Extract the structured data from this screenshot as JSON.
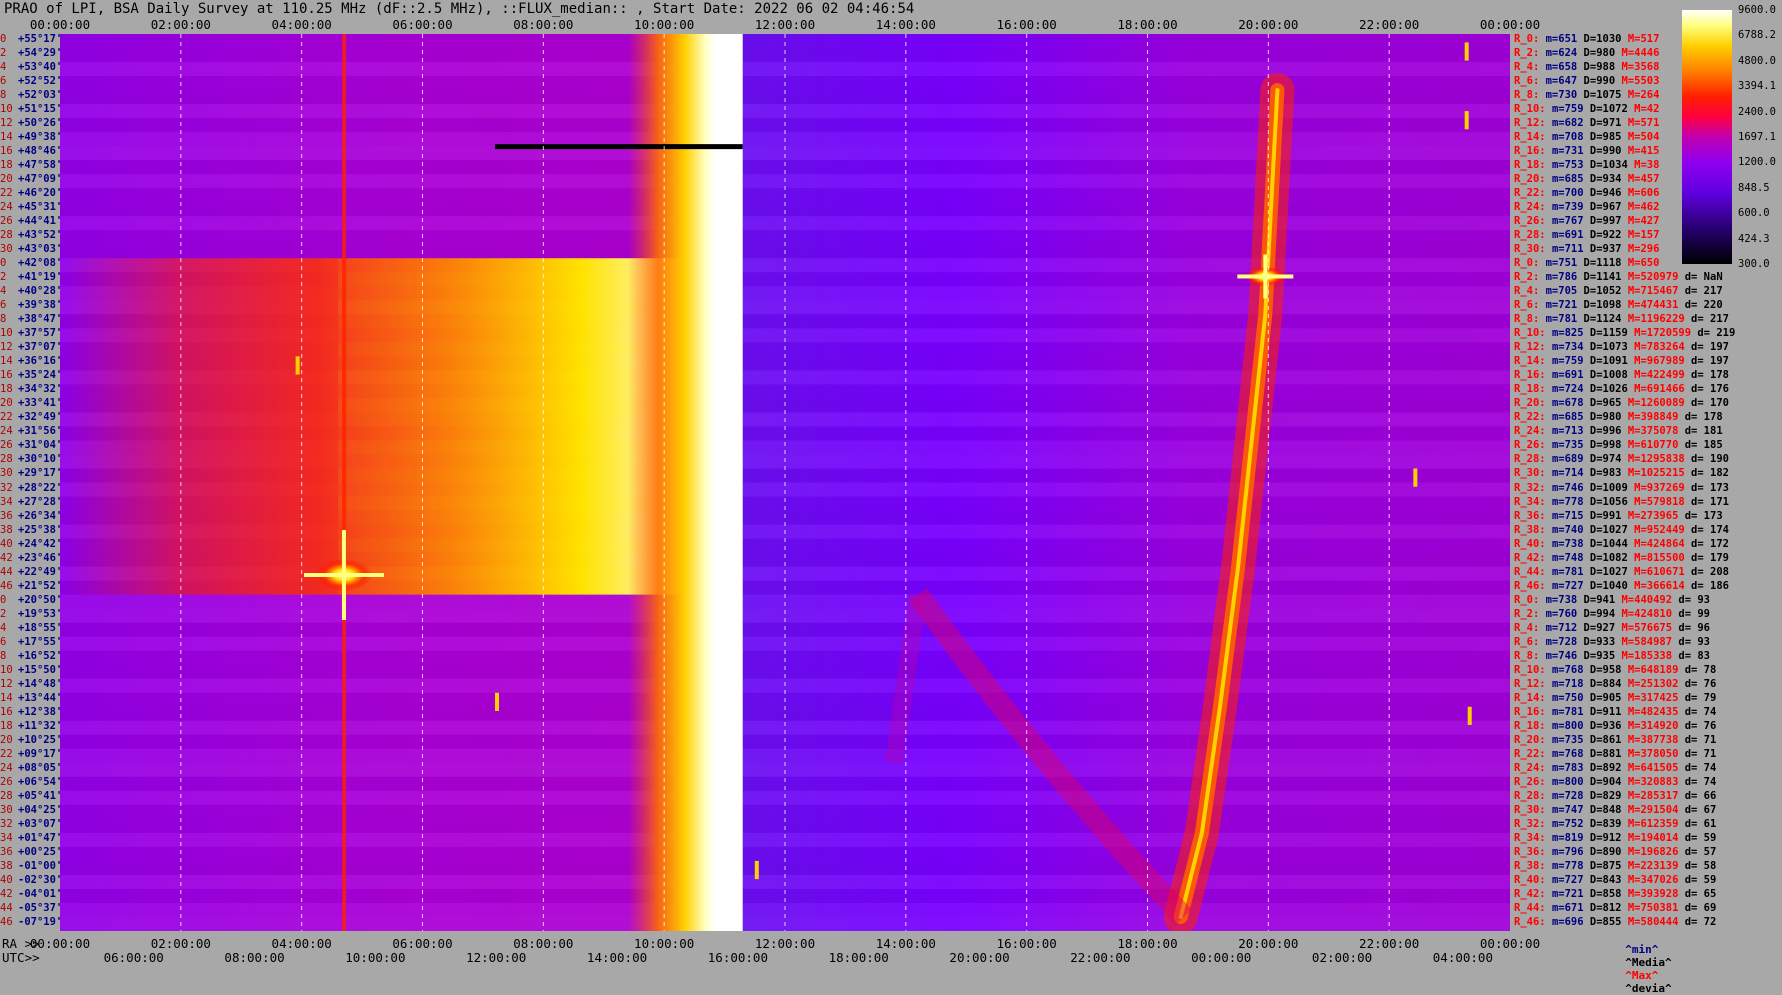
{
  "title": "PRAO of LPI, BSA Daily Survey at 110.25 MHz (dF::2.5 MHz), ::FLUX_median:: , Start Date: 2022 06 02 04:46:54",
  "top_ticks": [
    "00:00:00",
    "02:00:00",
    "04:00:00",
    "06:00:00",
    "08:00:00",
    "10:00:00",
    "12:00:00",
    "14:00:00",
    "16:00:00",
    "18:00:00",
    "20:00:00",
    "22:00:00",
    "00:00:00"
  ],
  "ra_label": "RA >>",
  "utc_label": "UTC>>",
  "ra_ticks": [
    "00:00:00",
    "02:00:00",
    "04:00:00",
    "06:00:00",
    "08:00:00",
    "10:00:00",
    "12:00:00",
    "14:00:00",
    "16:00:00",
    "18:00:00",
    "20:00:00",
    "22:00:00",
    "00:00:00"
  ],
  "utc_ticks": [
    "06:00:00",
    "08:00:00",
    "10:00:00",
    "12:00:00",
    "14:00:00",
    "16:00:00",
    "18:00:00",
    "20:00:00",
    "22:00:00",
    "00:00:00",
    "02:00:00",
    "04:00:00"
  ],
  "dec_labels": [
    {
      "i": "0",
      "v": "+55°17'"
    },
    {
      "i": "2",
      "v": "+54°29'"
    },
    {
      "i": "4",
      "v": "+53°40'"
    },
    {
      "i": "6",
      "v": "+52°52'"
    },
    {
      "i": "8",
      "v": "+52°03'"
    },
    {
      "i": "10",
      "v": "+51°15'"
    },
    {
      "i": "12",
      "v": "+50°26'"
    },
    {
      "i": "14",
      "v": "+49°38'"
    },
    {
      "i": "16",
      "v": "+48°46'"
    },
    {
      "i": "18",
      "v": "+47°58'"
    },
    {
      "i": "20",
      "v": "+47°09'"
    },
    {
      "i": "22",
      "v": "+46°20'"
    },
    {
      "i": "24",
      "v": "+45°31'"
    },
    {
      "i": "26",
      "v": "+44°41'"
    },
    {
      "i": "28",
      "v": "+43°52'"
    },
    {
      "i": "30",
      "v": "+43°03'"
    },
    {
      "i": "0",
      "v": "+42°08'"
    },
    {
      "i": "2",
      "v": "+41°19'"
    },
    {
      "i": "4",
      "v": "+40°28'"
    },
    {
      "i": "6",
      "v": "+39°38'"
    },
    {
      "i": "8",
      "v": "+38°47'"
    },
    {
      "i": "10",
      "v": "+37°57'"
    },
    {
      "i": "12",
      "v": "+37°07'"
    },
    {
      "i": "14",
      "v": "+36°16'"
    },
    {
      "i": "16",
      "v": "+35°24'"
    },
    {
      "i": "18",
      "v": "+34°32'"
    },
    {
      "i": "20",
      "v": "+33°41'"
    },
    {
      "i": "22",
      "v": "+32°49'"
    },
    {
      "i": "24",
      "v": "+31°56'"
    },
    {
      "i": "26",
      "v": "+31°04'"
    },
    {
      "i": "28",
      "v": "+30°10'"
    },
    {
      "i": "30",
      "v": "+29°17'"
    },
    {
      "i": "32",
      "v": "+28°22'"
    },
    {
      "i": "34",
      "v": "+27°28'"
    },
    {
      "i": "36",
      "v": "+26°34'"
    },
    {
      "i": "38",
      "v": "+25°38'"
    },
    {
      "i": "40",
      "v": "+24°42'"
    },
    {
      "i": "42",
      "v": "+23°46'"
    },
    {
      "i": "44",
      "v": "+22°49'"
    },
    {
      "i": "46",
      "v": "+21°52'"
    },
    {
      "i": "0",
      "v": "+20°50'"
    },
    {
      "i": "2",
      "v": "+19°53'"
    },
    {
      "i": "4",
      "v": "+18°55'"
    },
    {
      "i": "6",
      "v": "+17°55'"
    },
    {
      "i": "8",
      "v": "+16°52'"
    },
    {
      "i": "10",
      "v": "+15°50'"
    },
    {
      "i": "12",
      "v": "+14°48'"
    },
    {
      "i": "14",
      "v": "+13°44'"
    },
    {
      "i": "16",
      "v": "+12°38'"
    },
    {
      "i": "18",
      "v": "+11°32'"
    },
    {
      "i": "20",
      "v": "+10°25'"
    },
    {
      "i": "22",
      "v": "+09°17'"
    },
    {
      "i": "24",
      "v": "+08°05'"
    },
    {
      "i": "26",
      "v": "+06°54'"
    },
    {
      "i": "28",
      "v": "+05°41'"
    },
    {
      "i": "30",
      "v": "+04°25'"
    },
    {
      "i": "32",
      "v": "+03°07'"
    },
    {
      "i": "34",
      "v": "+01°47'"
    },
    {
      "i": "36",
      "v": "+00°25'"
    },
    {
      "i": "38",
      "v": "-01°00'"
    },
    {
      "i": "40",
      "v": "-02°30'"
    },
    {
      "i": "42",
      "v": "-04°01'"
    },
    {
      "i": "44",
      "v": "-05°37'"
    },
    {
      "i": "46",
      "v": "-07°19'"
    }
  ],
  "stats": [
    {
      "r": "R_0:",
      "m": "m=651",
      "d": "D=1030",
      "x": "M=517",
      "e": ""
    },
    {
      "r": "R_2:",
      "m": "m=624",
      "d": "D=980",
      "x": "M=4446",
      "e": ""
    },
    {
      "r": "R_4:",
      "m": "m=658",
      "d": "D=988",
      "x": "M=3568",
      "e": ""
    },
    {
      "r": "R_6:",
      "m": "m=647",
      "d": "D=990",
      "x": "M=5503",
      "e": ""
    },
    {
      "r": "R_8:",
      "m": "m=730",
      "d": "D=1075",
      "x": "M=264",
      "e": ""
    },
    {
      "r": "R_10:",
      "m": "m=759",
      "d": "D=1072",
      "x": "M=42",
      "e": ""
    },
    {
      "r": "R_12:",
      "m": "m=682",
      "d": "D=971",
      "x": "M=571",
      "e": ""
    },
    {
      "r": "R_14:",
      "m": "m=708",
      "d": "D=985",
      "x": "M=504",
      "e": ""
    },
    {
      "r": "R_16:",
      "m": "m=731",
      "d": "D=990",
      "x": "M=415",
      "e": ""
    },
    {
      "r": "R_18:",
      "m": "m=753",
      "d": "D=1034",
      "x": "M=38",
      "e": ""
    },
    {
      "r": "R_20:",
      "m": "m=685",
      "d": "D=934",
      "x": "M=457",
      "e": ""
    },
    {
      "r": "R_22:",
      "m": "m=700",
      "d": "D=946",
      "x": "M=606",
      "e": ""
    },
    {
      "r": "R_24:",
      "m": "m=739",
      "d": "D=967",
      "x": "M=462",
      "e": ""
    },
    {
      "r": "R_26:",
      "m": "m=767",
      "d": "D=997",
      "x": "M=427",
      "e": ""
    },
    {
      "r": "R_28:",
      "m": "m=691",
      "d": "D=922",
      "x": "M=157",
      "e": ""
    },
    {
      "r": "R_30:",
      "m": "m=711",
      "d": "D=937",
      "x": "M=296",
      "e": ""
    },
    {
      "r": "R_0:",
      "m": "m=751",
      "d": "D=1118",
      "x": "M=650",
      "e": ""
    },
    {
      "r": "R_2:",
      "m": "m=786",
      "d": "D=1141",
      "x": "M=520979",
      "e": "d= NaN"
    },
    {
      "r": "R_4:",
      "m": "m=705",
      "d": "D=1052",
      "x": "M=715467",
      "e": "d= 217"
    },
    {
      "r": "R_6:",
      "m": "m=721",
      "d": "D=1098",
      "x": "M=474431",
      "e": "d= 220"
    },
    {
      "r": "R_8:",
      "m": "m=781",
      "d": "D=1124",
      "x": "M=1196229",
      "e": "d= 217"
    },
    {
      "r": "R_10:",
      "m": "m=825",
      "d": "D=1159",
      "x": "M=1720599",
      "e": "d= 219"
    },
    {
      "r": "R_12:",
      "m": "m=734",
      "d": "D=1073",
      "x": "M=783264",
      "e": "d= 197"
    },
    {
      "r": "R_14:",
      "m": "m=759",
      "d": "D=1091",
      "x": "M=967989",
      "e": "d= 197"
    },
    {
      "r": "R_16:",
      "m": "m=691",
      "d": "D=1008",
      "x": "M=422499",
      "e": "d= 178"
    },
    {
      "r": "R_18:",
      "m": "m=724",
      "d": "D=1026",
      "x": "M=691466",
      "e": "d= 176"
    },
    {
      "r": "R_20:",
      "m": "m=678",
      "d": "D=965",
      "x": "M=1260089",
      "e": "d= 170"
    },
    {
      "r": "R_22:",
      "m": "m=685",
      "d": "D=980",
      "x": "M=398849",
      "e": "d= 178"
    },
    {
      "r": "R_24:",
      "m": "m=713",
      "d": "D=996",
      "x": "M=375078",
      "e": "d= 181"
    },
    {
      "r": "R_26:",
      "m": "m=735",
      "d": "D=998",
      "x": "M=610770",
      "e": "d= 185"
    },
    {
      "r": "R_28:",
      "m": "m=689",
      "d": "D=974",
      "x": "M=1295838",
      "e": "d= 190"
    },
    {
      "r": "R_30:",
      "m": "m=714",
      "d": "D=983",
      "x": "M=1025215",
      "e": "d= 182"
    },
    {
      "r": "R_32:",
      "m": "m=746",
      "d": "D=1009",
      "x": "M=937269",
      "e": "d= 173"
    },
    {
      "r": "R_34:",
      "m": "m=778",
      "d": "D=1056",
      "x": "M=579818",
      "e": "d= 171"
    },
    {
      "r": "R_36:",
      "m": "m=715",
      "d": "D=991",
      "x": "M=273965",
      "e": "d= 173"
    },
    {
      "r": "R_38:",
      "m": "m=740",
      "d": "D=1027",
      "x": "M=952449",
      "e": "d= 174"
    },
    {
      "r": "R_40:",
      "m": "m=738",
      "d": "D=1044",
      "x": "M=424864",
      "e": "d= 172"
    },
    {
      "r": "R_42:",
      "m": "m=748",
      "d": "D=1082",
      "x": "M=815500",
      "e": "d= 179"
    },
    {
      "r": "R_44:",
      "m": "m=781",
      "d": "D=1027",
      "x": "M=610671",
      "e": "d= 208"
    },
    {
      "r": "R_46:",
      "m": "m=727",
      "d": "D=1040",
      "x": "M=366614",
      "e": "d= 186"
    },
    {
      "r": "R_0:",
      "m": "m=738",
      "d": "D=941",
      "x": "M=440492",
      "e": "d= 93"
    },
    {
      "r": "R_2:",
      "m": "m=760",
      "d": "D=994",
      "x": "M=424810",
      "e": "d= 99"
    },
    {
      "r": "R_4:",
      "m": "m=712",
      "d": "D=927",
      "x": "M=576675",
      "e": "d= 96"
    },
    {
      "r": "R_6:",
      "m": "m=728",
      "d": "D=933",
      "x": "M=584987",
      "e": "d= 93"
    },
    {
      "r": "R_8:",
      "m": "m=746",
      "d": "D=935",
      "x": "M=185338",
      "e": "d= 83"
    },
    {
      "r": "R_10:",
      "m": "m=768",
      "d": "D=958",
      "x": "M=648189",
      "e": "d= 78"
    },
    {
      "r": "R_12:",
      "m": "m=718",
      "d": "D=884",
      "x": "M=251302",
      "e": "d= 76"
    },
    {
      "r": "R_14:",
      "m": "m=750",
      "d": "D=905",
      "x": "M=317425",
      "e": "d= 79"
    },
    {
      "r": "R_16:",
      "m": "m=781",
      "d": "D=911",
      "x": "M=482435",
      "e": "d= 74"
    },
    {
      "r": "R_18:",
      "m": "m=800",
      "d": "D=936",
      "x": "M=314920",
      "e": "d= 76"
    },
    {
      "r": "R_20:",
      "m": "m=735",
      "d": "D=861",
      "x": "M=387738",
      "e": "d= 71"
    },
    {
      "r": "R_22:",
      "m": "m=768",
      "d": "D=881",
      "x": "M=378050",
      "e": "d= 71"
    },
    {
      "r": "R_24:",
      "m": "m=783",
      "d": "D=892",
      "x": "M=641505",
      "e": "d= 74"
    },
    {
      "r": "R_26:",
      "m": "m=800",
      "d": "D=904",
      "x": "M=320883",
      "e": "d= 74"
    },
    {
      "r": "R_28:",
      "m": "m=728",
      "d": "D=829",
      "x": "M=285317",
      "e": "d= 66"
    },
    {
      "r": "R_30:",
      "m": "m=747",
      "d": "D=848",
      "x": "M=291504",
      "e": "d= 67"
    },
    {
      "r": "R_32:",
      "m": "m=752",
      "d": "D=839",
      "x": "M=612359",
      "e": "d= 61"
    },
    {
      "r": "R_34:",
      "m": "m=819",
      "d": "D=912",
      "x": "M=194014",
      "e": "d= 59"
    },
    {
      "r": "R_36:",
      "m": "m=796",
      "d": "D=890",
      "x": "M=196826",
      "e": "d= 57"
    },
    {
      "r": "R_38:",
      "m": "m=778",
      "d": "D=875",
      "x": "M=223139",
      "e": "d= 58"
    },
    {
      "r": "R_40:",
      "m": "m=727",
      "d": "D=843",
      "x": "M=347026",
      "e": "d= 59"
    },
    {
      "r": "R_42:",
      "m": "m=721",
      "d": "D=858",
      "x": "M=393928",
      "e": "d= 65"
    },
    {
      "r": "R_44:",
      "m": "m=671",
      "d": "D=812",
      "x": "M=750381",
      "e": "d= 69"
    },
    {
      "r": "R_46:",
      "m": "m=696",
      "d": "D=855",
      "x": "M=580444",
      "e": "d= 72"
    }
  ],
  "legend": {
    "min": "^min^",
    "median": "^Media^",
    "max": "^Max^",
    "devia": "^devia^"
  },
  "colorbar_labels": [
    "9600.0",
    "6788.2",
    "4800.0",
    "3394.1",
    "2400.0",
    "1697.1",
    "1200.0",
    "848.5",
    "600.0",
    "424.3",
    "300.0"
  ],
  "colors": {
    "background": "#a8a8a8",
    "low": "#000000",
    "mid_violet": "#7a00ff",
    "mid_red": "#ff0000",
    "high_yellow": "#ffff00",
    "max_white": "#ffffff"
  },
  "chart_data": {
    "type": "heatmap",
    "title": "PRAO of LPI, BSA Daily Survey at 110.25 MHz (dF::2.5 MHz), ::FLUX_median:: , Start Date: 2022 06 02 04:46:54",
    "x_axis_top": "RA 00:00:00 – 24:00:00",
    "x_axis_bottom": "UTC 06:00:00 – 04:00:00",
    "y_axis": "Declination, 64 beams from +55°17' to -07°19'",
    "color_scale": "log",
    "color_range": [
      300.0,
      9600.0
    ],
    "features": [
      {
        "name": "Sun transit band (saturated)",
        "ra_hours": [
          10.3,
          11.3
        ]
      },
      {
        "name": "Point source",
        "ra_hours": 4.7,
        "dec": "+22°49'"
      },
      {
        "name": "Cyg A strip",
        "ra_hours": [
          18.9,
          20.2
        ],
        "dec": [
          -7.3,
          44.0
        ]
      },
      {
        "name": "Point source",
        "ra_hours": 19.95,
        "dec": "+41°19'"
      }
    ]
  }
}
